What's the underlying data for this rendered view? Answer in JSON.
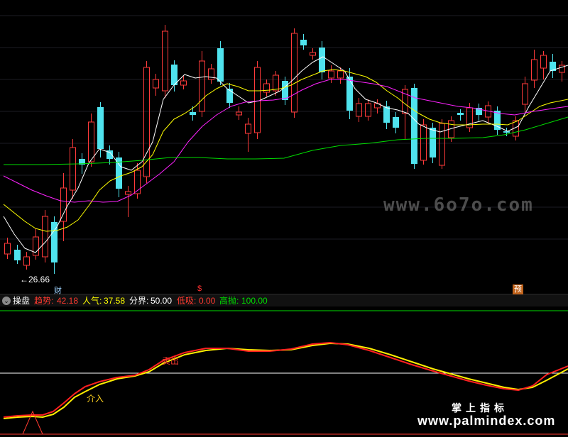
{
  "main_chart": {
    "low_marker_text": "←26.66",
    "markers": [
      {
        "id": "cai",
        "text": "财"
      },
      {
        "id": "s",
        "text": "$"
      },
      {
        "id": "yu",
        "text": "预"
      }
    ],
    "bullish_color": "#ff3a3a",
    "bearish_color": "#4fe3ee",
    "ma5_color": "#ffffff",
    "ma10_color": "#ffff00",
    "ma20_color": "#ff22ff",
    "ma60_color": "#00dd00"
  },
  "indicator_panel": {
    "name": "操盘",
    "legend": [
      {
        "label": "趋势:",
        "value": "42.18",
        "color": "#ff3a30"
      },
      {
        "label": "人气:",
        "value": "37.58",
        "color": "#ffff00"
      },
      {
        "label": "分界:",
        "value": "50.00",
        "color": "#ffffff"
      },
      {
        "label": "低吸:",
        "value": "0.00",
        "color": "#ff3a30"
      },
      {
        "label": "高抛:",
        "value": "100.00",
        "color": "#00dd00"
      }
    ],
    "signals": {
      "buy": "介入",
      "sell": "卖出"
    }
  },
  "watermarks": {
    "domain": "www.6o7o.com",
    "cn": "掌上指标",
    "site": "www.palmindex.com"
  }
}
